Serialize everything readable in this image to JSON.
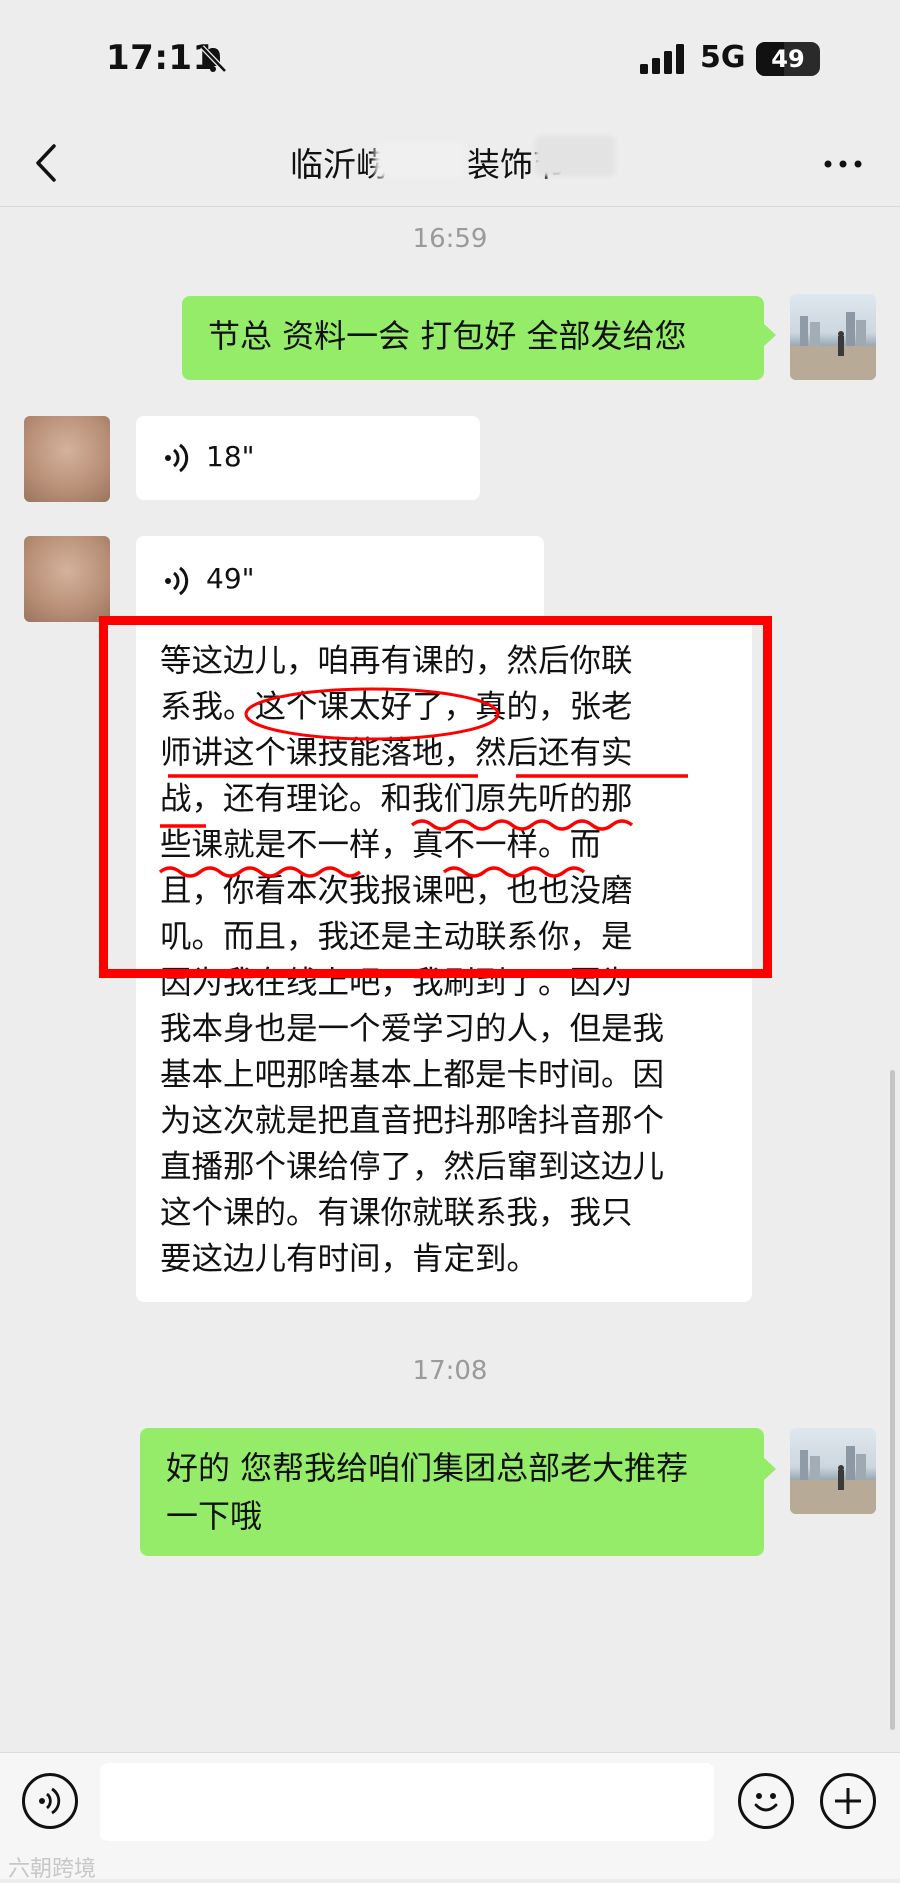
{
  "status": {
    "time": "17:11",
    "network": "5G",
    "battery": "49"
  },
  "nav": {
    "title": "临沂崂",
    "title_end": "装饰节"
  },
  "messages": {
    "t1": "16:59",
    "m1": "节总 资料一会 打包好 全部发给您",
    "v1": "18\"",
    "v2": "49\"",
    "transcript": [
      "等这边儿，咱再有课的，然后你联",
      "系我。这个课太好了，真的，张老",
      "师讲这个课技能落地，然后还有实",
      "战，还有理论。和我们原先听的那",
      "些课就是不一样，真不一样。而",
      "且，你看本次我报课吧，也也没磨",
      "叽。而且，我还是主动联系你，是",
      "因为我在线上吧，我刷到了。因为",
      "我本身也是一个爱学习的人，但是我",
      "基本上吧那啥基本上都是卡时间。因",
      "为这次就是把直音把抖那啥抖音那个",
      "直播那个课给停了，然后窜到这边儿",
      "这个课的。有课你就联系我，我只",
      "要这边儿有时间，肯定到。"
    ],
    "t2": "17:08",
    "m2_line1": "好的 您帮我给咱们集团总部老大推荐",
    "m2_line2": "一下哦"
  },
  "bottom": {
    "watermark": "六朝跨境"
  },
  "colors": {
    "green_bubble": "#95ec69",
    "highlight": "#ff0000",
    "background": "#ededed"
  }
}
